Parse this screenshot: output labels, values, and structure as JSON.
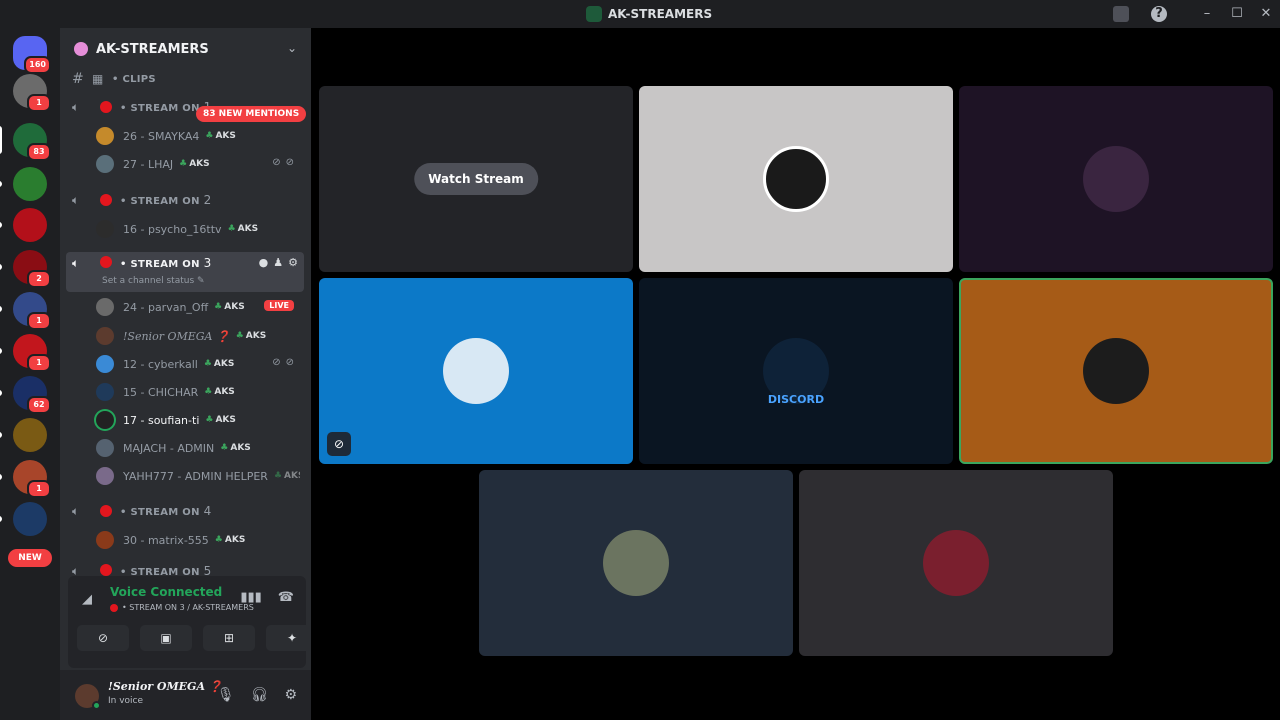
{
  "window": {
    "title": "AK-STREAMERS"
  },
  "rail": {
    "home_badge": "160",
    "servers": [
      {
        "badge": "1",
        "color": "#6b6b6b"
      },
      {
        "badge": "83",
        "color": "#1f6b3a"
      },
      {
        "badge": "",
        "color": "#2a7d2f"
      },
      {
        "badge": "",
        "color": "#b3101a"
      },
      {
        "badge": "2",
        "color": "#8a0d14"
      },
      {
        "badge": "1",
        "color": "#334a8a"
      },
      {
        "badge": "1",
        "color": "#c2161d"
      },
      {
        "badge": "62",
        "color": "#1a2f66"
      },
      {
        "badge": "",
        "color": "#7a5a14"
      },
      {
        "badge": "1",
        "color": "#a8452a"
      },
      {
        "badge": "",
        "color": "#1c3a66"
      }
    ],
    "new_label": "NEW"
  },
  "guild": {
    "name": "AK-STREAMERS"
  },
  "mentions_label": "83 NEW MENTIONS",
  "channels": {
    "clips": "• CLIPS",
    "stream1": {
      "prefix": "• STREAM ON ",
      "num": "1"
    },
    "stream2": {
      "prefix": "• STREAM ON ",
      "num": "2"
    },
    "stream3": {
      "prefix": "• STREAM ON ",
      "num": "3",
      "status": "Set a channel status"
    },
    "stream4": {
      "prefix": "• STREAM ON ",
      "num": "4"
    },
    "stream5": {
      "prefix": "• STREAM ON ",
      "num": "5"
    }
  },
  "tag_label": "AKS",
  "live_label": "LIVE",
  "members": {
    "smayka": "26 - SMAYKA4",
    "lhaj": "27 - LHAJ",
    "psycho": "16 - psycho_16ttv",
    "parvan": "24 - parvan_Off",
    "omega": "!Senior OMEGA ❓",
    "cyberkall": "12 - cyberkall",
    "chichar": "15 - CHICHAR",
    "soufian": "17 - soufian-ti",
    "majach": "MAJACH - ADMIN",
    "yahh": "YAHH777 - ADMIN HELPER",
    "matrix": "30 - matrix-555"
  },
  "voice": {
    "title": "Voice Connected",
    "channel": "• STREAM ON 3 / AK-STREAMERS"
  },
  "user": {
    "name": "!Senior OMEGA ❓",
    "status": "In voice"
  },
  "stream": {
    "watch_label": "Watch Stream",
    "discord_word": "DISCORD"
  },
  "colors": {
    "live_red": "#f23f42",
    "connected_green": "#23a55a",
    "speaking_border": "#3ba55d"
  }
}
